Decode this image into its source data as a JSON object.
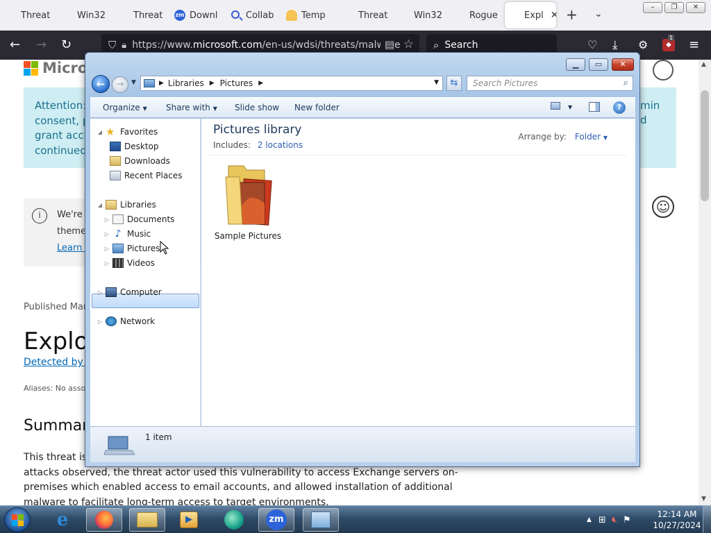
{
  "browser": {
    "tabs": [
      {
        "label": "Threat",
        "icon": "microsoft-icon"
      },
      {
        "label": "Win32",
        "icon": "microsoft-icon"
      },
      {
        "label": "Threat",
        "icon": "microsoft-icon"
      },
      {
        "label": "Downl",
        "icon": "zoom-icon"
      },
      {
        "label": "Collab",
        "icon": "search-icon"
      },
      {
        "label": "Temp",
        "icon": "temp-mail-icon"
      },
      {
        "label": "Threat",
        "icon": "microsoft-icon"
      },
      {
        "label": "Win32",
        "icon": "microsoft-icon"
      },
      {
        "label": "Rogue",
        "icon": "microsoft-icon"
      },
      {
        "label": "Expl",
        "icon": "microsoft-icon",
        "active": true
      }
    ],
    "url_prefix": "https://www.",
    "url_domain": "microsoft.com",
    "url_rest": "/en-us/wdsi/threats/malware",
    "search_placeholder": "Search",
    "extension_badge": "1"
  },
  "page": {
    "logo_text": "Microsoft",
    "attention_lines": [
      "Attention: W",
      "consent, pl",
      "grant acces",
      "continued a"
    ],
    "attention_right": [
      "min",
      "d"
    ],
    "notice_lines": [
      "We're g",
      "themed",
      "Learn a"
    ],
    "published": "Published Mar",
    "title": "Exploi",
    "detected_by": "Detected by M",
    "aliases": "Aliases: No assoc",
    "summary_heading": "Summar",
    "body_line1": "This threat is",
    "body_line2": "attacks observed, the threat actor used this vulnerability to access Exchange servers on-",
    "body_line3": "premises which enabled access to email accounts, and allowed installation of additional",
    "body_line4": "malware to facilitate long-term access to target environments."
  },
  "explorer": {
    "breadcrumb": [
      "Libraries",
      "Pictures"
    ],
    "search_placeholder": "Search Pictures",
    "toolbar": {
      "organize": "Organize",
      "share_with": "Share with",
      "slide_show": "Slide show",
      "new_folder": "New folder"
    },
    "nav": {
      "favorites": "Favorites",
      "desktop": "Desktop",
      "downloads": "Downloads",
      "recent_places": "Recent Places",
      "libraries": "Libraries",
      "documents": "Documents",
      "music": "Music",
      "pictures": "Pictures",
      "videos": "Videos",
      "computer": "Computer",
      "network": "Network"
    },
    "library_title": "Pictures library",
    "includes_label": "Includes:",
    "includes_link": "2 locations",
    "arrange_label": "Arrange by:",
    "arrange_value": "Folder",
    "items": [
      {
        "name": "Sample Pictures"
      }
    ],
    "status_count": "1 item"
  },
  "taskbar": {
    "time": "12:14 AM",
    "date": "10/27/2024",
    "zoom_label": "zm"
  },
  "colors": {
    "accent": "#1e395b",
    "link": "#2d5fb3",
    "firefox_dark": "#2b2a33"
  }
}
